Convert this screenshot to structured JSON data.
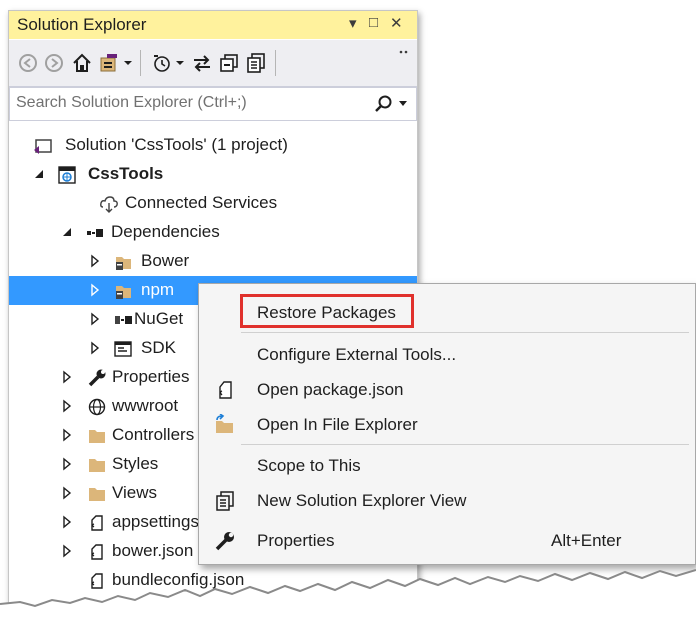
{
  "panel": {
    "title": "Solution Explorer",
    "controls": {
      "dropdown": "▾",
      "maximize": "□",
      "close": "✕"
    }
  },
  "search": {
    "placeholder": "Search Solution Explorer (Ctrl+;)",
    "value": ""
  },
  "tree": [
    {
      "label": "Solution 'CssTools' (1 project)",
      "icon": "solution-icon",
      "expander": "",
      "bold": false
    },
    {
      "label": "CssTools",
      "icon": "web-project-icon",
      "expander": "expanded",
      "bold": true
    },
    {
      "label": "Connected Services",
      "icon": "connected-services-icon",
      "expander": "",
      "bold": false
    },
    {
      "label": "Dependencies",
      "icon": "dependencies-icon",
      "expander": "expanded",
      "bold": false
    },
    {
      "label": "Bower",
      "icon": "folder-package-icon",
      "expander": "collapsed",
      "bold": false
    },
    {
      "label": "npm",
      "icon": "folder-package-icon",
      "expander": "collapsed",
      "bold": false,
      "selected": true
    },
    {
      "label": "NuGet",
      "icon": "nuget-icon",
      "expander": "collapsed",
      "bold": false
    },
    {
      "label": "SDK",
      "icon": "sdk-icon",
      "expander": "collapsed",
      "bold": false
    },
    {
      "label": "Properties",
      "icon": "wrench-icon",
      "expander": "collapsed",
      "bold": false
    },
    {
      "label": "wwwroot",
      "icon": "globe-icon",
      "expander": "collapsed",
      "bold": false
    },
    {
      "label": "Controllers",
      "icon": "folder-icon",
      "expander": "collapsed",
      "bold": false
    },
    {
      "label": "Styles",
      "icon": "folder-icon",
      "expander": "collapsed",
      "bold": false
    },
    {
      "label": "Views",
      "icon": "folder-icon",
      "expander": "collapsed",
      "bold": false
    },
    {
      "label": "appsettings.json",
      "icon": "json-file-icon",
      "expander": "collapsed",
      "bold": false
    },
    {
      "label": "bower.json",
      "icon": "json-file-icon",
      "expander": "collapsed",
      "bold": false
    },
    {
      "label": "bundleconfig.json",
      "icon": "json-file-icon",
      "expander": "",
      "bold": false
    }
  ],
  "context_menu": {
    "items": [
      {
        "label": "Restore Packages",
        "icon": "",
        "shortcut": "",
        "highlighted": true
      },
      {
        "label": "Configure External Tools...",
        "icon": "",
        "shortcut": ""
      },
      {
        "label": "Open package.json",
        "icon": "json-file-icon",
        "shortcut": ""
      },
      {
        "label": "Open In File Explorer",
        "icon": "folder-arrow-icon",
        "shortcut": ""
      },
      {
        "label": "Scope to This",
        "icon": "",
        "shortcut": ""
      },
      {
        "label": "New Solution Explorer View",
        "icon": "new-view-icon",
        "shortcut": ""
      },
      {
        "label": "Properties",
        "icon": "wrench-icon",
        "shortcut": "Alt+Enter"
      }
    ]
  },
  "colors": {
    "title_bar": "#fff29d",
    "selection": "#3399ff",
    "highlight_box": "#e0312c",
    "toolbar": "#eeeef2"
  }
}
